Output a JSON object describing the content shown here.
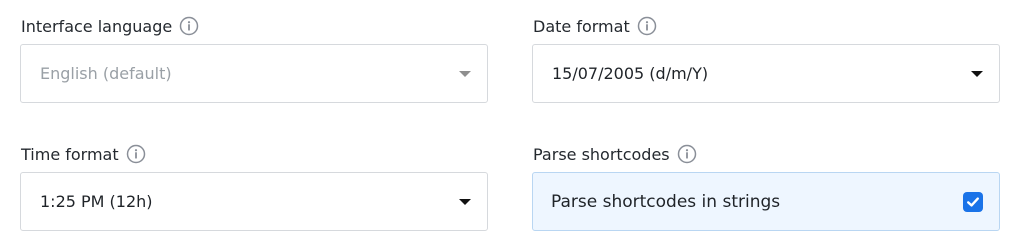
{
  "interface_language": {
    "label": "Interface language",
    "value": "English (default)"
  },
  "date_format": {
    "label": "Date format",
    "value": "15/07/2005 (d/m/Y)"
  },
  "time_format": {
    "label": "Time format",
    "value": "1:25 PM (12h)"
  },
  "parse_shortcodes": {
    "label": "Parse shortcodes",
    "checkbox_label": "Parse shortcodes in strings",
    "checked": true
  },
  "icons": {
    "info": "info-icon",
    "dropdown": "chevron-down-icon",
    "checkbox": "checkmark-icon"
  },
  "colors": {
    "accent": "#1a73e8",
    "checkbox_background": "#eef6ff",
    "border": "#d6d9dd"
  }
}
